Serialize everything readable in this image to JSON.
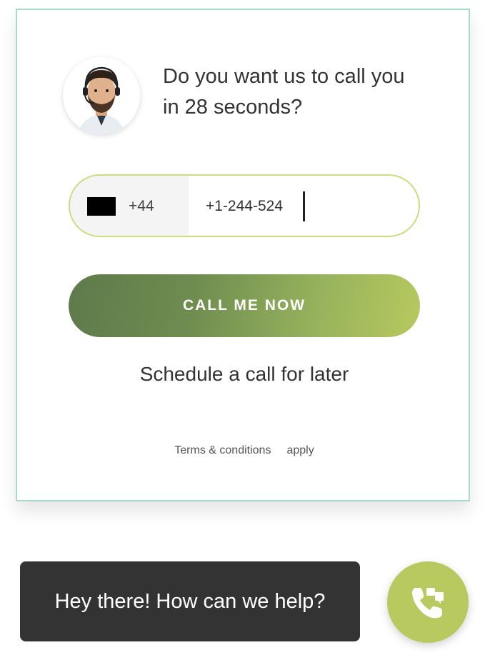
{
  "widget": {
    "prompt": "Do you want us to call you in 28 seconds?",
    "phone": {
      "country_flag_icon": "flag-icon",
      "dial_code": "+44",
      "value": "+1-244-524"
    },
    "call_button_label": "CALL ME NOW",
    "schedule_link": "Schedule a call for later",
    "terms_label": "Terms & conditions",
    "terms_apply": "apply"
  },
  "chat": {
    "bubble_text": "Hey there! How can we help?",
    "fab_icon": "phone-call-icon"
  },
  "colors": {
    "accent": "#b7c95f",
    "button_gradient_start": "#5e7a4b",
    "button_gradient_end": "#b7c95f",
    "card_border": "#a7dccc",
    "chat_bubble": "#333333"
  }
}
